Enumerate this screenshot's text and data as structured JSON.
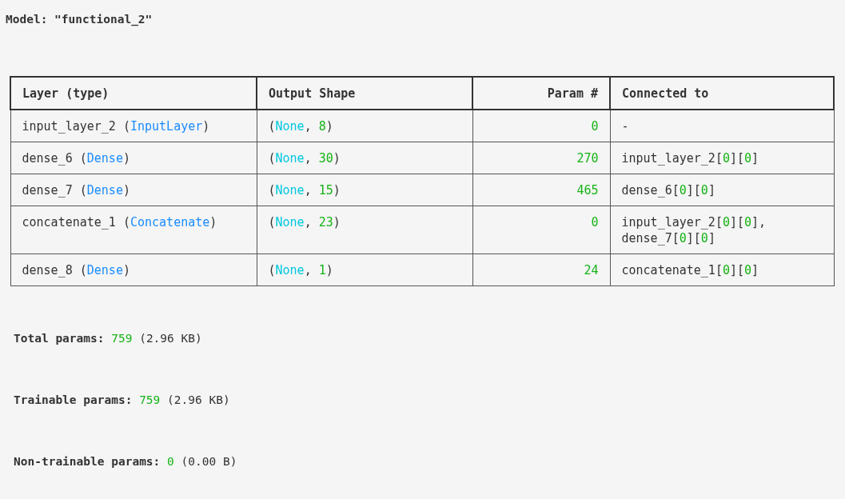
{
  "model_title": "Model: \"functional_2\"",
  "table": {
    "columns": [
      {
        "label": "Layer (type)",
        "kind": "text"
      },
      {
        "label": "Output Shape",
        "kind": "text"
      },
      {
        "label": "Param #",
        "kind": "count"
      },
      {
        "label": "Connected to",
        "kind": "text"
      }
    ],
    "rows": [
      {
        "cells": [
          [
            [
              {
                "kind": "text",
                "text": "input_layer_2 ("
              },
              {
                "kind": "type",
                "text": "InputLayer"
              },
              {
                "kind": "text",
                "text": ")"
              }
            ]
          ],
          [
            [
              {
                "kind": "text",
                "text": "("
              },
              {
                "kind": "none",
                "text": "None"
              },
              {
                "kind": "text",
                "text": ", "
              },
              {
                "kind": "number",
                "text": "8"
              },
              {
                "kind": "text",
                "text": ")"
              }
            ]
          ],
          [
            [
              {
                "kind": "number",
                "text": "0"
              }
            ]
          ],
          [
            [
              {
                "kind": "text",
                "text": "-"
              }
            ]
          ]
        ]
      },
      {
        "cells": [
          [
            [
              {
                "kind": "text",
                "text": "dense_6 ("
              },
              {
                "kind": "type",
                "text": "Dense"
              },
              {
                "kind": "text",
                "text": ")"
              }
            ]
          ],
          [
            [
              {
                "kind": "text",
                "text": "("
              },
              {
                "kind": "none",
                "text": "None"
              },
              {
                "kind": "text",
                "text": ", "
              },
              {
                "kind": "number",
                "text": "30"
              },
              {
                "kind": "text",
                "text": ")"
              }
            ]
          ],
          [
            [
              {
                "kind": "number",
                "text": "270"
              }
            ]
          ],
          [
            [
              {
                "kind": "text",
                "text": "input_layer_2["
              },
              {
                "kind": "number",
                "text": "0"
              },
              {
                "kind": "text",
                "text": "]["
              },
              {
                "kind": "number",
                "text": "0"
              },
              {
                "kind": "text",
                "text": "]"
              }
            ]
          ]
        ]
      },
      {
        "cells": [
          [
            [
              {
                "kind": "text",
                "text": "dense_7 ("
              },
              {
                "kind": "type",
                "text": "Dense"
              },
              {
                "kind": "text",
                "text": ")"
              }
            ]
          ],
          [
            [
              {
                "kind": "text",
                "text": "("
              },
              {
                "kind": "none",
                "text": "None"
              },
              {
                "kind": "text",
                "text": ", "
              },
              {
                "kind": "number",
                "text": "15"
              },
              {
                "kind": "text",
                "text": ")"
              }
            ]
          ],
          [
            [
              {
                "kind": "number",
                "text": "465"
              }
            ]
          ],
          [
            [
              {
                "kind": "text",
                "text": "dense_6["
              },
              {
                "kind": "number",
                "text": "0"
              },
              {
                "kind": "text",
                "text": "]["
              },
              {
                "kind": "number",
                "text": "0"
              },
              {
                "kind": "text",
                "text": "]"
              }
            ]
          ]
        ]
      },
      {
        "cells": [
          [
            [
              {
                "kind": "text",
                "text": "concatenate_1 ("
              },
              {
                "kind": "type",
                "text": "Concatenate"
              },
              {
                "kind": "text",
                "text": ")"
              }
            ]
          ],
          [
            [
              {
                "kind": "text",
                "text": "("
              },
              {
                "kind": "none",
                "text": "None"
              },
              {
                "kind": "text",
                "text": ", "
              },
              {
                "kind": "number",
                "text": "23"
              },
              {
                "kind": "text",
                "text": ")"
              }
            ]
          ],
          [
            [
              {
                "kind": "number",
                "text": "0"
              }
            ]
          ],
          [
            [
              {
                "kind": "text",
                "text": "input_layer_2["
              },
              {
                "kind": "number",
                "text": "0"
              },
              {
                "kind": "text",
                "text": "]["
              },
              {
                "kind": "number",
                "text": "0"
              },
              {
                "kind": "text",
                "text": "],"
              }
            ],
            [
              {
                "kind": "text",
                "text": "dense_7["
              },
              {
                "kind": "number",
                "text": "0"
              },
              {
                "kind": "text",
                "text": "]["
              },
              {
                "kind": "number",
                "text": "0"
              },
              {
                "kind": "text",
                "text": "]"
              }
            ]
          ]
        ]
      },
      {
        "cells": [
          [
            [
              {
                "kind": "text",
                "text": "dense_8 ("
              },
              {
                "kind": "type",
                "text": "Dense"
              },
              {
                "kind": "text",
                "text": ")"
              }
            ]
          ],
          [
            [
              {
                "kind": "text",
                "text": "("
              },
              {
                "kind": "none",
                "text": "None"
              },
              {
                "kind": "text",
                "text": ", "
              },
              {
                "kind": "number",
                "text": "1"
              },
              {
                "kind": "text",
                "text": ")"
              }
            ]
          ],
          [
            [
              {
                "kind": "number",
                "text": "24"
              }
            ]
          ],
          [
            [
              {
                "kind": "text",
                "text": "concatenate_1["
              },
              {
                "kind": "number",
                "text": "0"
              },
              {
                "kind": "text",
                "text": "]["
              },
              {
                "kind": "number",
                "text": "0"
              },
              {
                "kind": "text",
                "text": "]"
              }
            ]
          ]
        ]
      }
    ]
  },
  "summary": [
    [
      {
        "kind": "label",
        "text": "Total params: "
      },
      {
        "kind": "number",
        "text": "759"
      },
      {
        "kind": "text",
        "text": " (2.96 KB)"
      }
    ],
    [
      {
        "kind": "label",
        "text": "Trainable params: "
      },
      {
        "kind": "number",
        "text": "759"
      },
      {
        "kind": "text",
        "text": " (2.96 KB)"
      }
    ],
    [
      {
        "kind": "label",
        "text": "Non-trainable params: "
      },
      {
        "kind": "number",
        "text": "0"
      },
      {
        "kind": "text",
        "text": " (0.00 B)"
      }
    ]
  ]
}
